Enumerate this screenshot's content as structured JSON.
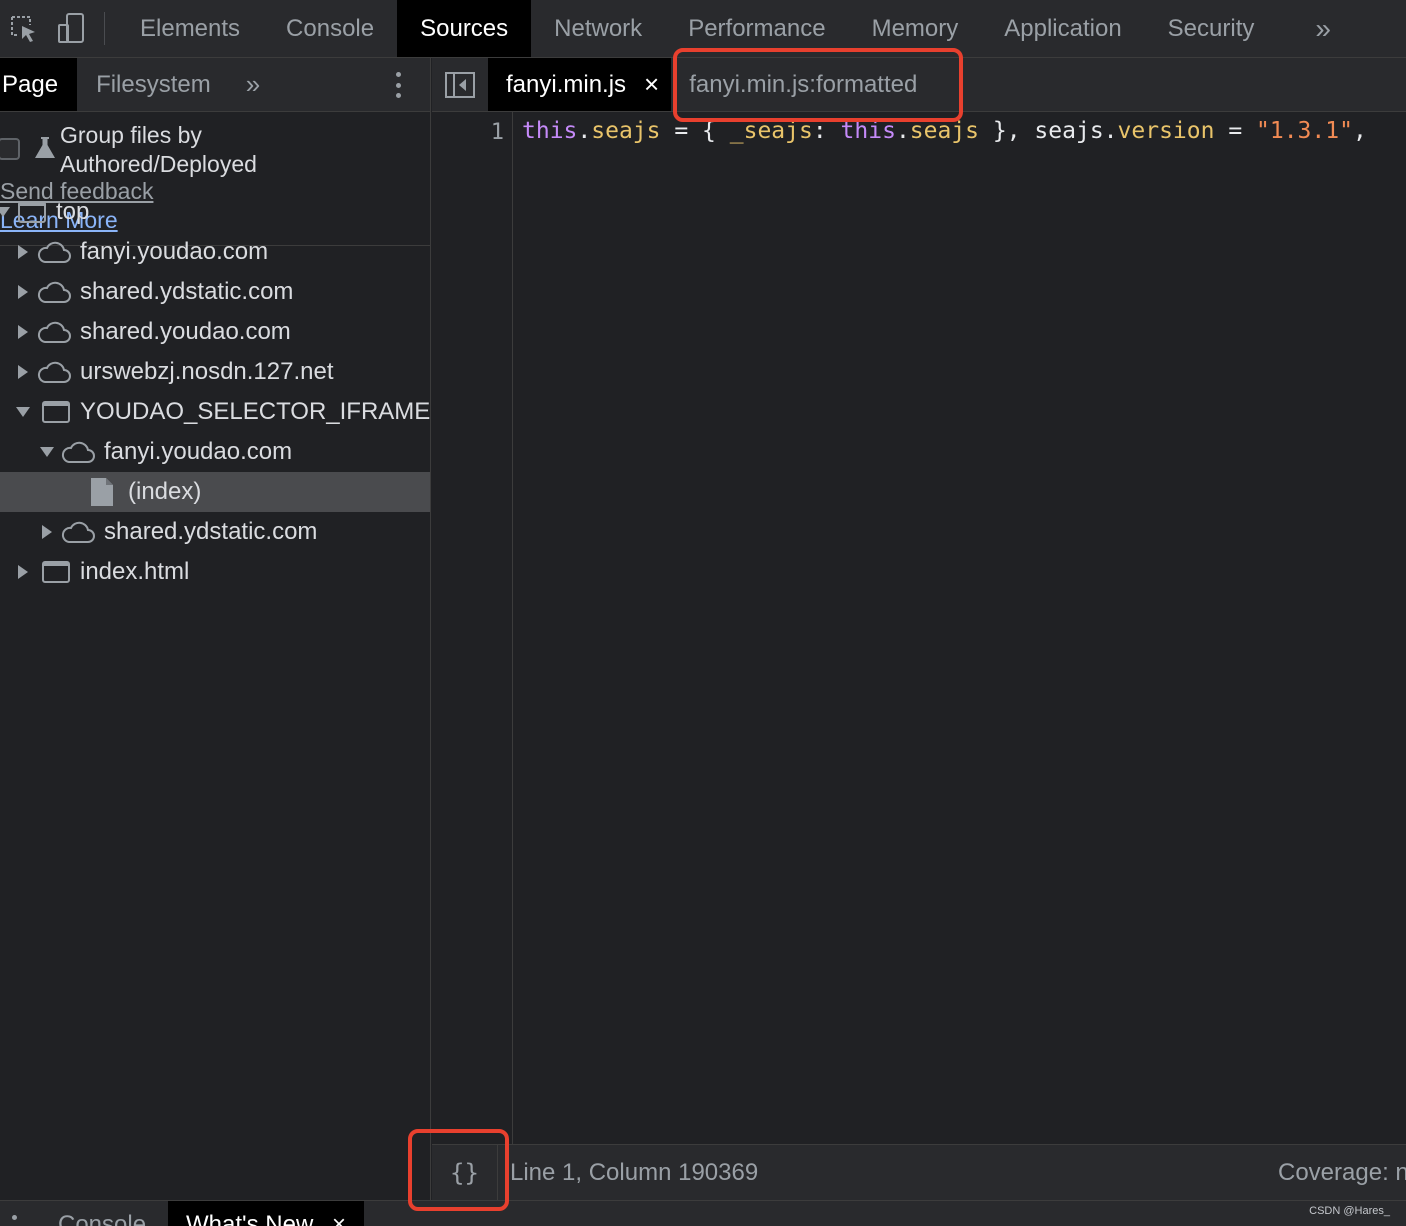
{
  "toolbar": {
    "tabs": [
      "Elements",
      "Console",
      "Sources",
      "Network",
      "Performance",
      "Memory",
      "Application",
      "Security"
    ],
    "active_tab": "Sources",
    "more": "»"
  },
  "navigator": {
    "tabs": [
      "Page",
      "Filesystem"
    ],
    "more": "»",
    "group_files_label": "Group files by Authored/Deployed",
    "send_feedback": "Send feedback",
    "learn_more": "Learn More",
    "tree": [
      {
        "label": "top"
      },
      {
        "label": "fanyi.youdao.com"
      },
      {
        "label": "shared.ydstatic.com"
      },
      {
        "label": "shared.youdao.com"
      },
      {
        "label": "urswebzj.nosdn.127.net"
      },
      {
        "label": "YOUDAO_SELECTOR_IFRAME ("
      },
      {
        "label": "fanyi.youdao.com"
      },
      {
        "label": "(index)"
      },
      {
        "label": "shared.ydstatic.com"
      },
      {
        "label": "index.html"
      }
    ]
  },
  "editor": {
    "tabs": [
      "fanyi.min.js",
      "fanyi.min.js:formatted"
    ],
    "close": "×",
    "line_number": "1",
    "code": {
      "t1": "this",
      "t2": ".",
      "t3": "seajs",
      "t4": " = { ",
      "t5": "_seajs",
      "t6": ": ",
      "t7": "this",
      "t8": ".",
      "t9": "seajs",
      "t10": " }, seajs.",
      "t11": "version",
      "t12": " = ",
      "t13": "\"1.3.1\"",
      "t14": ","
    }
  },
  "status": {
    "pretty_print": "{}",
    "position": "Line 1, Column 190369",
    "coverage": "Coverage: n"
  },
  "drawer": {
    "tabs": [
      "Console",
      "What's New"
    ],
    "close": "×"
  },
  "watermark": "CSDN @Hares_",
  "colors": {
    "highlight": "#e8402e",
    "keyword": "#c58af9",
    "property": "#e9c46a",
    "string": "#f28b54",
    "link": "#8ab4f8"
  }
}
